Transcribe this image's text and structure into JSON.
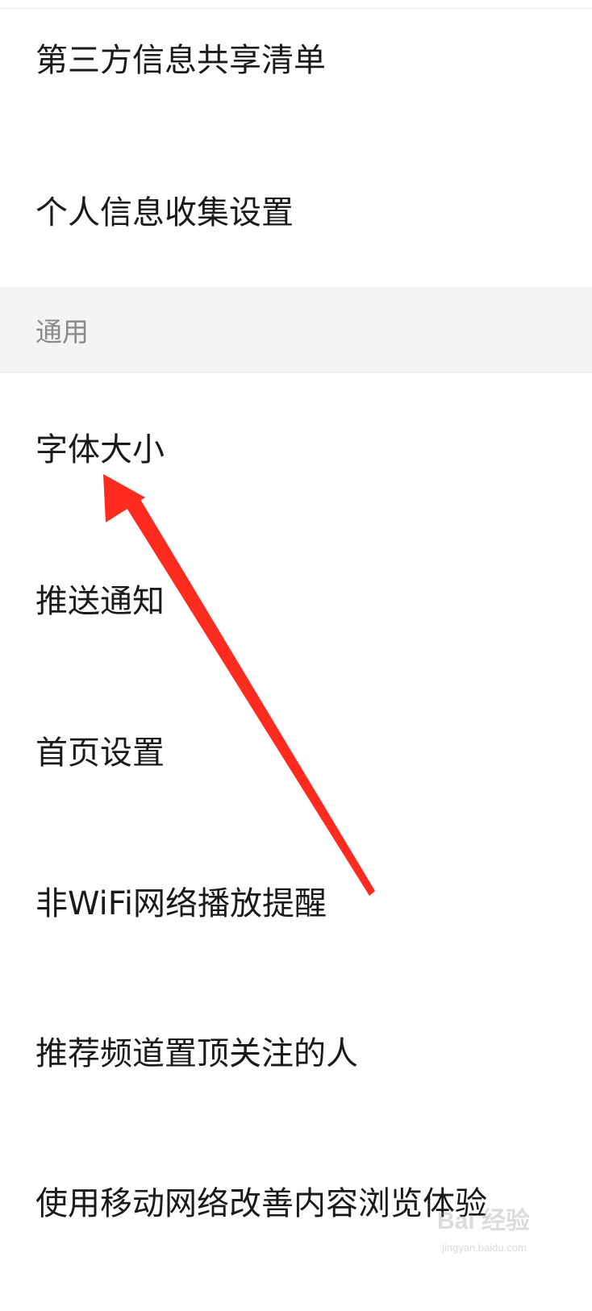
{
  "settings": {
    "section_privacy_items": [
      "第三方信息共享清单",
      "个人信息收集设置"
    ],
    "general_section_title": "通用",
    "general_items": [
      "字体大小",
      "推送通知",
      "首页设置",
      "非WiFi网络播放提醒",
      "推荐频道置顶关注的人",
      "使用移动网络改善内容浏览体验"
    ]
  },
  "annotation": {
    "arrow_color": "#ff2b1f"
  },
  "watermark": {
    "logo_text": "Bai 经验",
    "url_text": "jingyan.baidu.com"
  }
}
